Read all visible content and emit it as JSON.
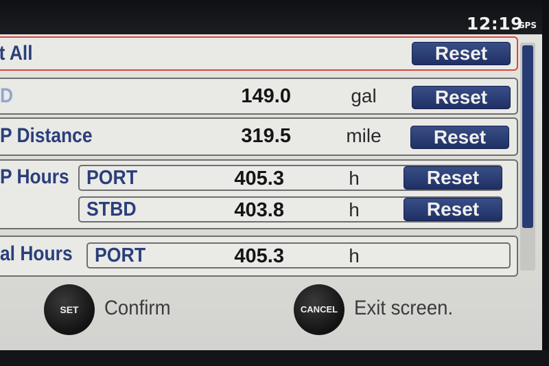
{
  "status_bar": {
    "time": "12:19",
    "gps": "GPS"
  },
  "rows": [
    {
      "label": "et All",
      "button": "Reset"
    },
    {
      "label": "D",
      "value": "149.0",
      "unit": "gal",
      "button": "Reset"
    },
    {
      "label": "P Distance",
      "value": "319.5",
      "unit": "mile",
      "button": "Reset"
    },
    {
      "label": "P Hours",
      "sub": [
        {
          "name": "PORT",
          "value": "405.3",
          "unit": "h",
          "button": "Reset"
        },
        {
          "name": "STBD",
          "value": "403.8",
          "unit": "h",
          "button": "Reset"
        }
      ]
    },
    {
      "label": "al Hours",
      "sub": [
        {
          "name": "PORT",
          "value": "405.3",
          "unit": "h"
        }
      ]
    }
  ],
  "footer": {
    "set": {
      "key": "SET",
      "text": "Confirm"
    },
    "cancel": {
      "key": "CANCEL",
      "text": "Exit screen."
    }
  },
  "colors": {
    "accent": "#2a3f7a",
    "button": "#1e2f63",
    "selected_border": "#d8463e"
  }
}
